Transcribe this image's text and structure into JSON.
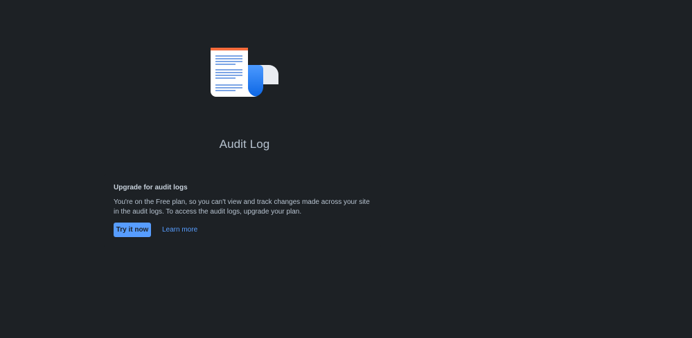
{
  "page": {
    "title": "Audit Log",
    "illustration_icon": "document-scroll-icon"
  },
  "upgrade_card": {
    "heading": "Upgrade for audit logs",
    "body": "You're on the Free plan, so you can't view and track changes made across your site in the audit logs. To access the audit logs, upgrade your plan.",
    "primary_button_label": "Try it now",
    "secondary_link_label": "Learn more"
  },
  "colors": {
    "background": "#1d2125",
    "accent": "#579dff",
    "text": "#b6c2cf",
    "heading_text": "#c7d1db",
    "illustration_orange": "#f56b3b",
    "illustration_blue": "#1d7afc"
  }
}
